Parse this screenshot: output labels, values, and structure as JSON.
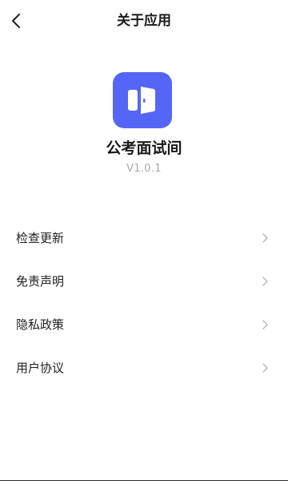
{
  "header": {
    "title": "关于应用",
    "back_icon": "chevron-left-icon"
  },
  "app": {
    "icon": "door-icon",
    "icon_color": "#5566f7",
    "name": "公考面试间",
    "version": "V1.0.1"
  },
  "menu": {
    "items": [
      {
        "label": "检查更新",
        "icon": "chevron-right-icon"
      },
      {
        "label": "免责声明",
        "icon": "chevron-right-icon"
      },
      {
        "label": "隐私政策",
        "icon": "chevron-right-icon"
      },
      {
        "label": "用户协议",
        "icon": "chevron-right-icon"
      }
    ]
  }
}
